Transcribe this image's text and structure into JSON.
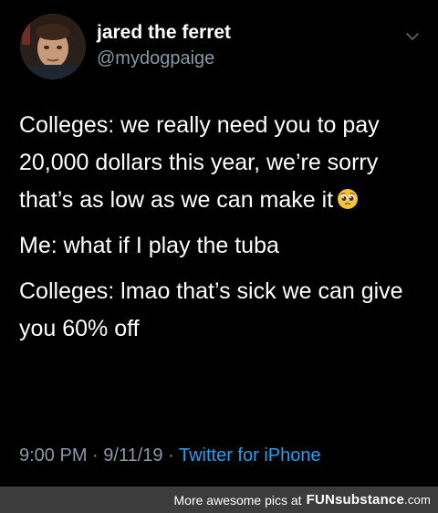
{
  "author": {
    "display_name": "jared the ferret",
    "handle": "@mydogpaige",
    "avatar_icon": "profile-photo"
  },
  "tweet": {
    "paragraphs": [
      "Colleges: we really need you to pay 20,000 dollars this year, we’re sorry that’s as low as we can make it",
      "Me: what if I play the tuba",
      "Colleges: lmao that’s sick we can give you 60% off"
    ],
    "emoji": "pleading-face-emoji"
  },
  "meta": {
    "time": "9:00 PM",
    "separator": "·",
    "date": "9/11/19",
    "source": "Twitter for iPhone"
  },
  "footer": {
    "text": "More awesome pics at",
    "brand_fun": "FUN",
    "brand_rest": "substance",
    "brand_domain": ".com"
  },
  "colors": {
    "background": "#000000",
    "text": "#ffffff",
    "muted": "#8b98a5",
    "link": "#1da1f2",
    "footer_bg": "#3c3c3c"
  }
}
